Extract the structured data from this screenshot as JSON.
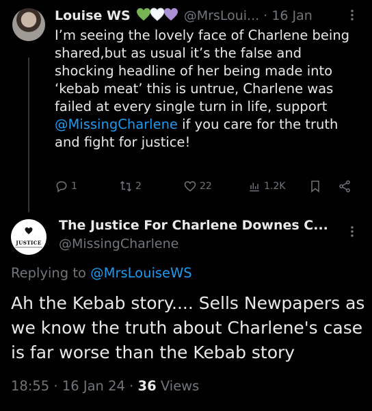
{
  "colors": {
    "background": "#000000",
    "text": "#e7e9ea",
    "muted": "#71767b",
    "link": "#1d9bf0"
  },
  "tweet1": {
    "name": "Louise WS",
    "hearts": [
      "green-heart-icon",
      "white-heart-icon",
      "purple-heart-icon"
    ],
    "handle": "@MrsLoui...",
    "separator": "·",
    "date": "16 Jan",
    "text_before_mention": "I’m seeing the lovely face of Charlene being shared,but as usual it’s the false and shocking headline of her being made into ‘kebab meat’ this is untrue, Charlene was failed at every single turn in life, support ",
    "mention": "@MissingCharlene",
    "text_after_mention": " if you care for the truth and fight for justice!",
    "replies": "1",
    "retweets": "2",
    "likes": "22",
    "views": "1.2K"
  },
  "tweet2": {
    "name": "The Justice For Charlene Downes C...",
    "handle": "@MissingCharlene",
    "avatar_text": "JUSTICE",
    "replying_to_label": "Replying to",
    "replying_to_handle": "@MrsLouiseWS",
    "text": "Ah the Kebab story.... Sells Newpapers as we know the truth about Charlene's case is far worse than the Kebab story",
    "time": "18:55",
    "date": "16 Jan 24",
    "views_count": "36",
    "views_label": "Views"
  }
}
